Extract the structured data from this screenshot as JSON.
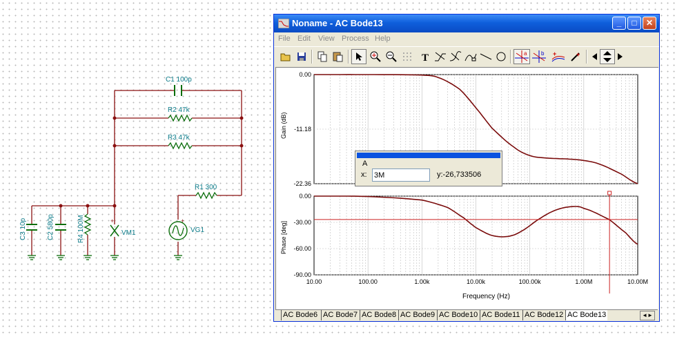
{
  "schematic": {
    "components": {
      "c1": "C1 100p",
      "r2": "R2 47k",
      "r3": "R3 47k",
      "r1": "R1 300",
      "c3": "C3 10p",
      "c2": "C2 580p",
      "r4": "R4 100M",
      "vm1": "VM1",
      "vg1": "VG1"
    }
  },
  "window": {
    "title": "Noname - AC Bode13",
    "controls": {
      "minimize": "_",
      "maximize": "□",
      "close": "✕"
    },
    "menu": [
      "File",
      "Edit",
      "View",
      "Process",
      "Help"
    ],
    "toolbar": [
      "open-icon",
      "save-icon",
      "copy-icon",
      "paste-icon",
      "pointer-icon",
      "zoom-in-icon",
      "zoom-100-icon",
      "grid-icon",
      "text-icon",
      "line-tool-icon",
      "curve-tool-icon",
      "freehand-icon",
      "straight-line-icon",
      "circle-icon",
      "cursor-a-icon",
      "cursor-b-icon",
      "add-marker-icon",
      "pick-icon",
      "arrow-left-icon",
      "arrow-updown-icon",
      "arrow-right-icon"
    ]
  },
  "cursor_panel": {
    "name": "A",
    "x_label": "x:",
    "x_value": "3M",
    "y_readout": "y:-26,733506"
  },
  "tabs": [
    "AC Bode6",
    "AC Bode7",
    "AC Bode8",
    "AC Bode9",
    "AC Bode10",
    "AC Bode11",
    "AC Bode12",
    "AC Bode13"
  ],
  "active_tab": "AC Bode13",
  "colors": {
    "curve": "#7a0b0b",
    "cursor": "#cc2222",
    "grid": "#bdbdbd",
    "title_bar": "#0f5fdc"
  },
  "chart_data": [
    {
      "type": "line",
      "ylabel": "Gain (dB)",
      "xlabel": "",
      "x_scale": "log",
      "xlim": [
        10,
        10000000
      ],
      "ylim": [
        -22.36,
        0
      ],
      "y_ticks": [
        "0.00",
        "-11.18",
        "-22.36"
      ],
      "grid": true,
      "x": [
        10,
        100,
        1000,
        2000,
        5000,
        10000,
        20000,
        50000,
        100000,
        200000,
        500000,
        1000000,
        2000000,
        5000000,
        10000000
      ],
      "series": [
        {
          "values": [
            0,
            0,
            -0.1,
            -0.6,
            -3.0,
            -6.8,
            -11.0,
            -14.8,
            -16.6,
            -17.1,
            -17.3,
            -17.6,
            -18.4,
            -20.4,
            -22.36
          ]
        }
      ]
    },
    {
      "type": "line",
      "ylabel": "Phase [deg]",
      "xlabel": "Frequency (Hz)",
      "x_scale": "log",
      "xlim": [
        10,
        10000000
      ],
      "ylim": [
        -90,
        0
      ],
      "y_ticks": [
        "0.00",
        "-30.00",
        "-60.00",
        "-90.00"
      ],
      "x_ticks": [
        "10.00",
        "100.00",
        "1.00k",
        "10.00k",
        "100.00k",
        "1.00M",
        "10.00M"
      ],
      "grid": true,
      "cursor_x": 3000000,
      "cursor_y": -26.73,
      "x": [
        10,
        100,
        1000,
        3000,
        6000,
        10000,
        20000,
        40000,
        70000,
        150000,
        300000,
        600000,
        1000000,
        3000000,
        6000000,
        10000000
      ],
      "series": [
        {
          "values": [
            0,
            -0.5,
            -4.5,
            -13.0,
            -25.0,
            -36.0,
            -45.0,
            -46.0,
            -40.0,
            -26.0,
            -16.0,
            -12.0,
            -14.0,
            -27.0,
            -42.0,
            -55.0
          ]
        }
      ]
    }
  ]
}
